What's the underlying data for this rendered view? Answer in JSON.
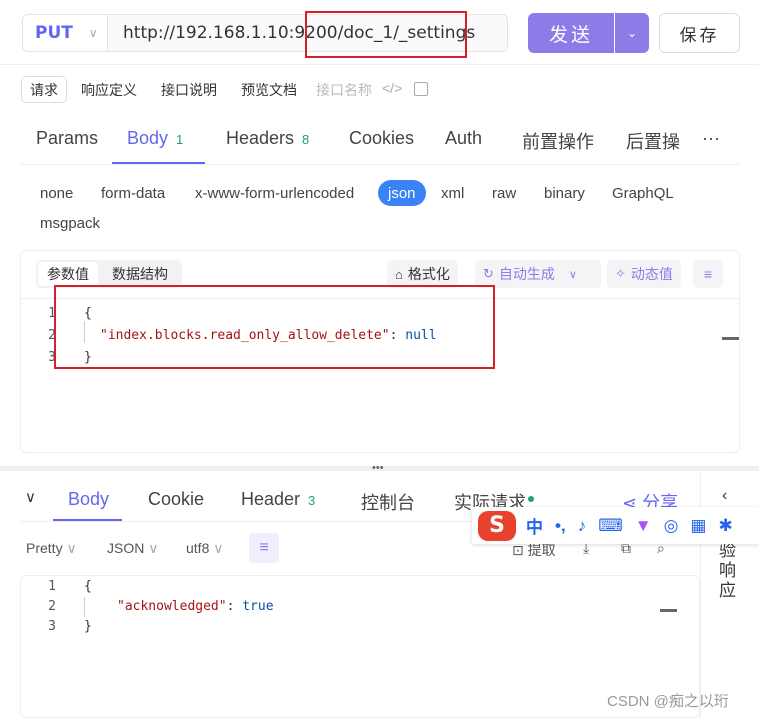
{
  "request": {
    "method": "PUT",
    "url": "http://192.168.1.10:9200/doc_1/_settings",
    "send_label": "发送",
    "save_label": "保存"
  },
  "sub_tabs": [
    "请求",
    "响应定义",
    "接口说明",
    "预览文档",
    "接口名称"
  ],
  "main_tabs": [
    {
      "label": "Params"
    },
    {
      "label": "Body",
      "badge": "1"
    },
    {
      "label": "Headers",
      "badge": "8"
    },
    {
      "label": "Cookies"
    },
    {
      "label": "Auth"
    },
    {
      "label": "前置操作"
    },
    {
      "label": "后置操"
    }
  ],
  "body_types": [
    "none",
    "form-data",
    "x-www-form-urlencoded",
    "json",
    "xml",
    "raw",
    "binary",
    "GraphQL",
    "msgpack"
  ],
  "editor": {
    "seg_tabs": [
      "参数值",
      "数据结构"
    ],
    "format_label": "格式化",
    "auto_gen_label": "自动生成",
    "dynamic_label": "动态值",
    "lines": [
      {
        "n": "1",
        "open": "{"
      },
      {
        "n": "2",
        "key": "\"index.blocks.read_only_allow_delete\"",
        "sep": ": ",
        "val": "null"
      },
      {
        "n": "3",
        "close": "}"
      }
    ]
  },
  "response": {
    "tabs": [
      "Body",
      "Cookie",
      "Header",
      "控制台",
      "实际请求"
    ],
    "header_badge": "3",
    "share_label": "分享",
    "format": "Pretty",
    "lang": "JSON",
    "encoding": "utf8",
    "extract_label": "提取",
    "lines": [
      {
        "n": "1",
        "open": "{"
      },
      {
        "n": "2",
        "key": "\"acknowledged\"",
        "sep": ": ",
        "val": "true"
      },
      {
        "n": "3",
        "close": "}"
      }
    ],
    "side_label": "验响应"
  },
  "ime": {
    "logo": "S",
    "lang": "中"
  },
  "watermark": "CSDN @痴之以珩",
  "colors": {
    "accent": "#6366f1",
    "send": "#8b7ce8",
    "highlight": "#d81e28",
    "json_active": "#3b82f6"
  }
}
